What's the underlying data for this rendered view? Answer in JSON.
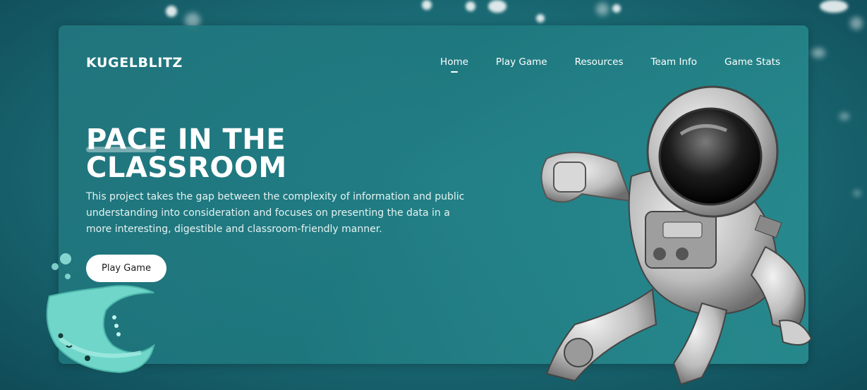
{
  "brand": {
    "logo": "KUGELBLITZ"
  },
  "nav": {
    "items": [
      {
        "label": "Home",
        "active": true
      },
      {
        "label": "Play Game",
        "active": false
      },
      {
        "label": "Resources",
        "active": false
      },
      {
        "label": "Team Info",
        "active": false
      },
      {
        "label": "Game Stats",
        "active": false
      }
    ]
  },
  "hero": {
    "title_line1": "PACE IN THE",
    "title_line2": "CLASSROOM",
    "description": "This project takes the gap between the complexity of information and public understanding into consideration and focuses on presenting the data in a more interesting, digestible and classroom-friendly manner.",
    "cta_label": "Play Game"
  },
  "illustrations": {
    "astronaut": "astronaut-illustration",
    "stingray": "stingray-mascot"
  },
  "colors": {
    "background": "#1c6f79",
    "card": "#237880",
    "text": "#ffffff",
    "button": "#ffffff",
    "stingray": "#6fd6c9"
  }
}
